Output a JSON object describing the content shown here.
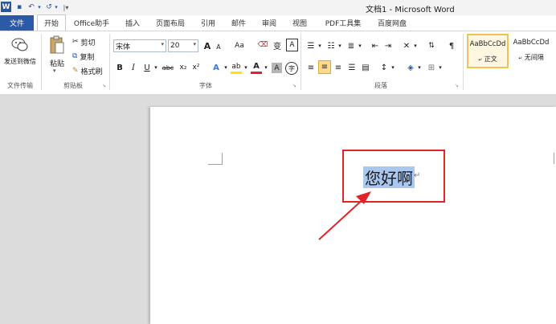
{
  "titlebar": {
    "app_title": "文档1 - Microsoft Word",
    "quick_access": [
      "save-icon",
      "undo-icon",
      "redo-icon",
      "customize-icon"
    ],
    "glyphs": {
      "save": "▪",
      "undo": "↶",
      "undo_dd": "▾",
      "redo": "↺",
      "redo_dd": "▾",
      "customize": "|▾"
    }
  },
  "tabs": [
    {
      "label": "文件"
    },
    {
      "label": "开始"
    },
    {
      "label": "Office助手"
    },
    {
      "label": "插入"
    },
    {
      "label": "页面布局"
    },
    {
      "label": "引用"
    },
    {
      "label": "邮件"
    },
    {
      "label": "审阅"
    },
    {
      "label": "视图"
    },
    {
      "label": "PDF工具集"
    },
    {
      "label": "百度网盘"
    }
  ],
  "ribbon": {
    "wechat_group": {
      "send_label": "发送到微信",
      "group_label": "文件传输"
    },
    "clipboard": {
      "paste_label": "粘贴",
      "cut_label": "剪切",
      "copy_label": "复制",
      "format_painter_label": "格式刷",
      "group_label": "剪贴板"
    },
    "font": {
      "font_name": "宋体",
      "font_size": "20",
      "grow_label": "A",
      "shrink_label": "A",
      "change_case_label": "Aa",
      "phonetic_label": "变",
      "char_border_label": "A",
      "bold": "B",
      "italic": "I",
      "underline": "U",
      "strikethrough": "abc",
      "subscript": "x₂",
      "superscript": "x²",
      "text_effect": "A",
      "highlight": "ab",
      "font_color": "A",
      "char_shading": "A",
      "enclose": "字",
      "group_label": "字体"
    },
    "paragraph": {
      "group_label": "段落"
    },
    "styles": {
      "items": [
        {
          "preview": "AaBbCcDd",
          "name": "正文"
        },
        {
          "preview": "AaBbCcDd",
          "name": "无间隔"
        }
      ]
    }
  },
  "document": {
    "selected_text": "您好啊",
    "paragraph_mark": "↵"
  },
  "colors": {
    "file_tab": "#2a5aa8",
    "annotation": "#e1242a",
    "selection": "#a8c8ef",
    "style_selected": "#f2c25a"
  }
}
